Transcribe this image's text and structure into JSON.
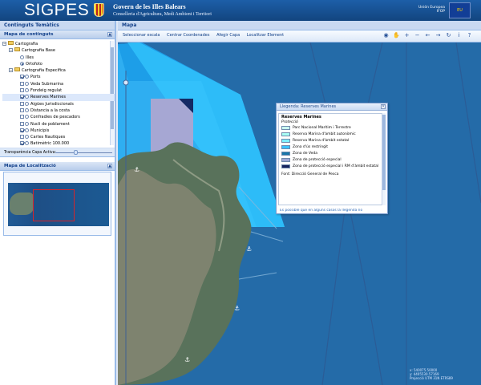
{
  "header": {
    "app_title": "SIGPES",
    "government": "Govern de les Illes Balears",
    "department": "Conselleria d'Agricultura, Medi Ambient i Territori",
    "eu_line1": "Unión Europea",
    "eu_line2": "IFOP",
    "eu_flag_label": "EU"
  },
  "left_panel": {
    "title": "Continguts Temàtics",
    "layers_heading": "Mapa de continguts",
    "collapse_symbol": "▲",
    "tree": [
      {
        "label": "Cartografia",
        "level": 0,
        "kind": "folder",
        "expander": "−"
      },
      {
        "label": "Cartografia Base",
        "level": 1,
        "kind": "folder",
        "expander": "−"
      },
      {
        "label": "Illes",
        "level": 2,
        "kind": "radio",
        "checked": false
      },
      {
        "label": "Ortofoto",
        "level": 2,
        "kind": "radio",
        "checked": true
      },
      {
        "label": "Cartografia Especifica",
        "level": 1,
        "kind": "folder",
        "expander": "−"
      },
      {
        "label": "Ports",
        "level": 2,
        "kind": "layer",
        "checked": true
      },
      {
        "label": "Veda Submarina",
        "level": 2,
        "kind": "layer",
        "checked": false
      },
      {
        "label": "Fondeig regulat",
        "level": 2,
        "kind": "layer",
        "checked": false
      },
      {
        "label": "Reserves Marines",
        "level": 2,
        "kind": "layer",
        "checked": true,
        "selected": true
      },
      {
        "label": "Aigües Jurisdiccionals",
        "level": 2,
        "kind": "layer",
        "checked": false
      },
      {
        "label": "Distancia a la costa",
        "level": 2,
        "kind": "layer",
        "checked": false
      },
      {
        "label": "Confradies de pescadors",
        "level": 2,
        "kind": "layer",
        "checked": false
      },
      {
        "label": "Nucli de poblament",
        "level": 2,
        "kind": "layer",
        "checked": false
      },
      {
        "label": "Municipis",
        "level": 2,
        "kind": "layer",
        "checked": true
      },
      {
        "label": "Cartes Nautiques",
        "level": 2,
        "kind": "layer",
        "checked": false
      },
      {
        "label": "Batimètric 100.000",
        "level": 2,
        "kind": "layer",
        "checked": true
      }
    ],
    "transparency_label": "Transparència Capa Activa:",
    "transparency_value": 0.32,
    "locator_heading": "Mapa de Localització"
  },
  "main_panel": {
    "title": "Mapa",
    "toolbar": {
      "items": [
        "Seleccionar escala",
        "Centrar Coordenades",
        "Afegir Capa",
        "Localitzar Element"
      ],
      "icons": [
        "globe-icon",
        "hand-icon",
        "zoom-in-icon",
        "zoom-out-icon",
        "back-icon",
        "forward-icon",
        "refresh-icon",
        "info-icon",
        "help-icon"
      ],
      "icon_glyphs": [
        "◉",
        "✋",
        "+",
        "−",
        "←",
        "→",
        "↻",
        "i",
        "?"
      ]
    },
    "legend": {
      "title": "Llegenda: Reserves Marines",
      "close_symbol": "×",
      "heading": "Reserves Marines",
      "subheading": "Protecció",
      "items": [
        {
          "label": "Parc Nacional Marítim i Terrestre",
          "color": "#c9fff0"
        },
        {
          "label": "Reserva Marina d'àmbit autonòmic",
          "color": "#a9fff5"
        },
        {
          "label": "Reserva Marina d'àmbit estatal",
          "color": "#7ef0ff"
        },
        {
          "label": "Zona d'ús restringit",
          "color": "#3cc2ff"
        },
        {
          "label": "Zona de Veda",
          "color": "#1976a9"
        },
        {
          "label": "Zona de protecció especial",
          "color": "#9da7d4"
        },
        {
          "label": "Zona de protecció especial i RM d'àmbit estatal",
          "color": "#15235e"
        }
      ],
      "source": "Font: Direcció General de Pesca",
      "footer": "Es possible que en alguns casos la llegenda no"
    },
    "coordinates": {
      "x": "x: 540075.50000",
      "y": "y: 4405530.57169",
      "projection": "Projecció UTM 31N ETRS89"
    }
  }
}
